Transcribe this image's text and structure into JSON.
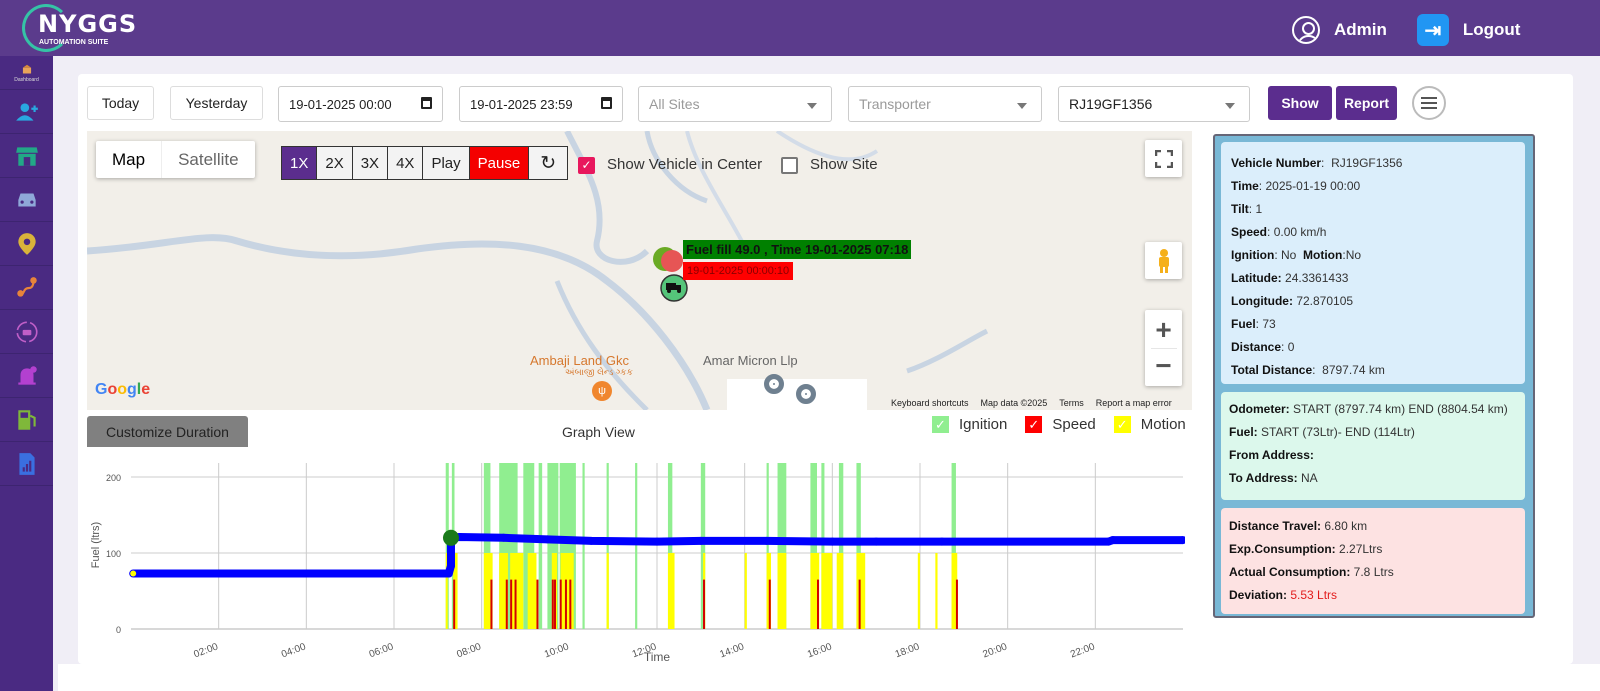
{
  "header": {
    "logo_title": "NYGGS",
    "logo_subtitle": "AUTOMATION SUITE",
    "user_label": "Admin",
    "logout_label": "Logout"
  },
  "sidebar": {
    "items": [
      {
        "icon": "dashboard-icon",
        "label": "Dashboard"
      },
      {
        "icon": "add-user-icon",
        "label": ""
      },
      {
        "icon": "store-icon",
        "label": ""
      },
      {
        "icon": "car-icon",
        "label": ""
      },
      {
        "icon": "location-pin-icon",
        "label": ""
      },
      {
        "icon": "route-icon",
        "label": ""
      },
      {
        "icon": "vehicle-sync-icon",
        "label": ""
      },
      {
        "icon": "alert-settings-icon",
        "label": ""
      },
      {
        "icon": "fuel-pump-icon",
        "label": ""
      },
      {
        "icon": "report-chart-icon",
        "label": ""
      }
    ]
  },
  "filters": {
    "today_label": "Today",
    "yesterday_label": "Yesterday",
    "from_datetime": "19-01-2025 00:00",
    "to_datetime": "19-01-2025 23:59",
    "sites_placeholder": "All Sites",
    "transporter_placeholder": "Transporter",
    "vehicle_selected": "RJ19GF1356",
    "show_label": "Show",
    "report_label": "Report"
  },
  "map": {
    "type_map": "Map",
    "type_satellite": "Satellite",
    "speed_options": [
      "1X",
      "2X",
      "3X",
      "4X"
    ],
    "active_speed": "1X",
    "play_label": "Play",
    "pause_label": "Pause",
    "show_vehicle_center_label": "Show Vehicle in Center",
    "show_vehicle_center_checked": true,
    "show_site_label": "Show Site",
    "show_site_checked": false,
    "fuel_fill_label": "Fuel fill 49.0 , Time 19-01-2025 07:18",
    "marker_time_label": "19-01-2025 00:00:10",
    "poi_1": "Ambaji Land Gkc",
    "poi_1_local": "અંબાજી લેન્ડ ગ્કક",
    "poi_2": "Amar Micron Llp",
    "footer": [
      "Keyboard shortcuts",
      "Map data ©2025",
      "Terms",
      "Report a map error"
    ],
    "google_logo": "Google"
  },
  "graph": {
    "customize_label": "Customize Duration",
    "title": "Graph View",
    "legend": [
      {
        "name": "Ignition",
        "color": "#90ee90",
        "checked": true
      },
      {
        "name": "Speed",
        "color": "#ff0000",
        "checked": true
      },
      {
        "name": "Motion",
        "color": "#ffff00",
        "checked": true
      }
    ]
  },
  "chart_data": {
    "type": "line",
    "title": "Graph View",
    "xlabel": "Time",
    "ylabel": "Fuel (ltrs)",
    "ylim": [
      0,
      200
    ],
    "yticks": [
      0,
      100,
      200
    ],
    "xlim_hours": [
      0,
      24
    ],
    "xticks": [
      "02:00",
      "04:00",
      "06:00",
      "08:00",
      "10:00",
      "12:00",
      "14:00",
      "16:00",
      "18:00",
      "20:00",
      "22:00"
    ],
    "grid": true,
    "legend_position": "top-right",
    "series": [
      {
        "name": "Fuel",
        "color": "#0000ff",
        "points_hours": [
          [
            0.05,
            73
          ],
          [
            7.25,
            73
          ],
          [
            7.3,
            83
          ],
          [
            7.3,
            120
          ],
          [
            7.5,
            121
          ],
          [
            8.5,
            120
          ],
          [
            9.5,
            118
          ],
          [
            10.5,
            116
          ],
          [
            12,
            115
          ],
          [
            13.0,
            116
          ],
          [
            14.5,
            116
          ],
          [
            16.0,
            115
          ],
          [
            17.0,
            115
          ],
          [
            18.5,
            115
          ],
          [
            22.3,
            115
          ],
          [
            22.4,
            117
          ],
          [
            24,
            117
          ]
        ]
      }
    ],
    "fuel_fill_event": {
      "time": "07:18",
      "value": 120
    },
    "ignition_bands_hours": [
      [
        7.18,
        7.25
      ],
      [
        7.32,
        7.38
      ],
      [
        8.05,
        8.2
      ],
      [
        8.4,
        8.82
      ],
      [
        8.95,
        9.2
      ],
      [
        9.3,
        9.38
      ],
      [
        9.5,
        9.75
      ],
      [
        9.78,
        10.15
      ],
      [
        10.3,
        10.35
      ],
      [
        10.85,
        10.9
      ],
      [
        11.5,
        11.55
      ],
      [
        12.25,
        12.35
      ],
      [
        13.0,
        13.1
      ],
      [
        14.5,
        14.55
      ],
      [
        14.75,
        14.95
      ],
      [
        15.5,
        15.65
      ],
      [
        15.75,
        15.82
      ],
      [
        16.15,
        16.25
      ],
      [
        16.55,
        16.65
      ],
      [
        18.72,
        18.82
      ]
    ],
    "motion_bands_hours": [
      [
        7.18,
        7.22
      ],
      [
        7.35,
        7.45
      ],
      [
        8.05,
        8.25
      ],
      [
        8.4,
        8.6
      ],
      [
        8.65,
        8.95
      ],
      [
        9.05,
        9.25
      ],
      [
        9.6,
        9.72
      ],
      [
        9.8,
        10.1
      ],
      [
        10.85,
        10.9
      ],
      [
        12.25,
        12.4
      ],
      [
        13.05,
        13.1
      ],
      [
        14.0,
        14.05
      ],
      [
        14.5,
        14.6
      ],
      [
        14.75,
        14.95
      ],
      [
        15.5,
        15.7
      ],
      [
        15.75,
        16.0
      ],
      [
        16.1,
        16.25
      ],
      [
        16.55,
        16.75
      ],
      [
        17.95,
        18.0
      ],
      [
        18.35,
        18.4
      ],
      [
        18.72,
        18.85
      ]
    ],
    "speed_spikes_hours": [
      7.35,
      8.2,
      8.55,
      8.65,
      8.75,
      9.25,
      9.6,
      9.65,
      9.78,
      9.9,
      10.0,
      13.05,
      14.55,
      15.65,
      16.6,
      18.82
    ]
  },
  "vehicle_info": {
    "vehicle_number_label": "Vehicle Number",
    "vehicle_number": "RJ19GF1356",
    "time_label": "Time",
    "time": "2025-01-19 00:00",
    "tilt_label": "Tilt",
    "tilt": "1",
    "speed_label": "Speed",
    "speed": "0.00 km/h",
    "ignition_label": "Ignition",
    "ignition": "No",
    "motion_label": "Motion",
    "motion": "No",
    "latitude_label": "Latitude:",
    "latitude": "24.3361433",
    "longitude_label": "Longitude:",
    "longitude": "72.870105",
    "fuel_label": "Fuel",
    "fuel": "73",
    "distance_label": "Distance",
    "distance": "0",
    "total_distance_label": "Total Distance",
    "total_distance": "8797.74 km"
  },
  "trip_summary": {
    "odometer_label": "Odometer:",
    "odometer": "START (8797.74 km) END (8804.54 km)",
    "fuel_label": "Fuel:",
    "fuel": "START (73Ltr)- END (114Ltr)",
    "from_address_label": "From Address:",
    "from_address": "",
    "to_address_label": "To Address:",
    "to_address": "NA"
  },
  "consumption": {
    "distance_travel_label": "Distance Travel:",
    "distance_travel": "6.80 km",
    "exp_consumption_label": "Exp.Consumption:",
    "exp_consumption": "2.27Ltrs",
    "actual_consumption_label": "Actual Consumption:",
    "actual_consumption": "7.8 Ltrs",
    "deviation_label": "Deviation:",
    "deviation": "5.53 Ltrs",
    "deviation_color": "#e21b1b"
  }
}
